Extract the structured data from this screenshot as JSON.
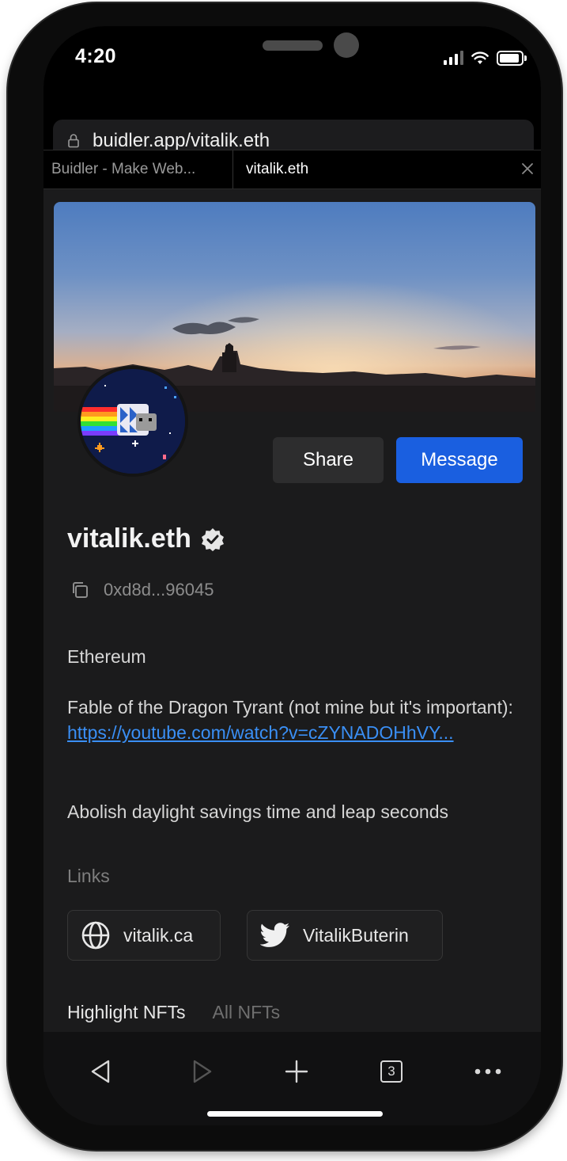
{
  "status_bar": {
    "time": "4:20"
  },
  "browser": {
    "url": "buidler.app/vitalik.eth",
    "tabs": [
      {
        "label": "Buidler - Make Web..."
      },
      {
        "label": "vitalik.eth"
      }
    ],
    "tab_count": "3"
  },
  "profile": {
    "buttons": {
      "share": "Share",
      "message": "Message"
    },
    "name": "vitalik.eth",
    "address": "0xd8d...96045",
    "bio": {
      "line1": "Ethereum",
      "line2_text": "Fable of the Dragon Tyrant (not mine but it's important): ",
      "line2_link": "https://youtube.com/watch?v=cZYNADOHhVY...",
      "line3": "Abolish daylight savings time and leap seconds"
    },
    "links_label": "Links",
    "links": [
      {
        "label": "vitalik.ca",
        "icon": "globe-icon"
      },
      {
        "label": "VitalikButerin",
        "icon": "twitter-icon"
      }
    ],
    "nft_tabs": {
      "highlight": "Highlight NFTs",
      "all": "All NFTs"
    }
  },
  "colors": {
    "background": "#1b1b1c",
    "accent": "#1a5fe0",
    "link": "#3a8ff5"
  }
}
